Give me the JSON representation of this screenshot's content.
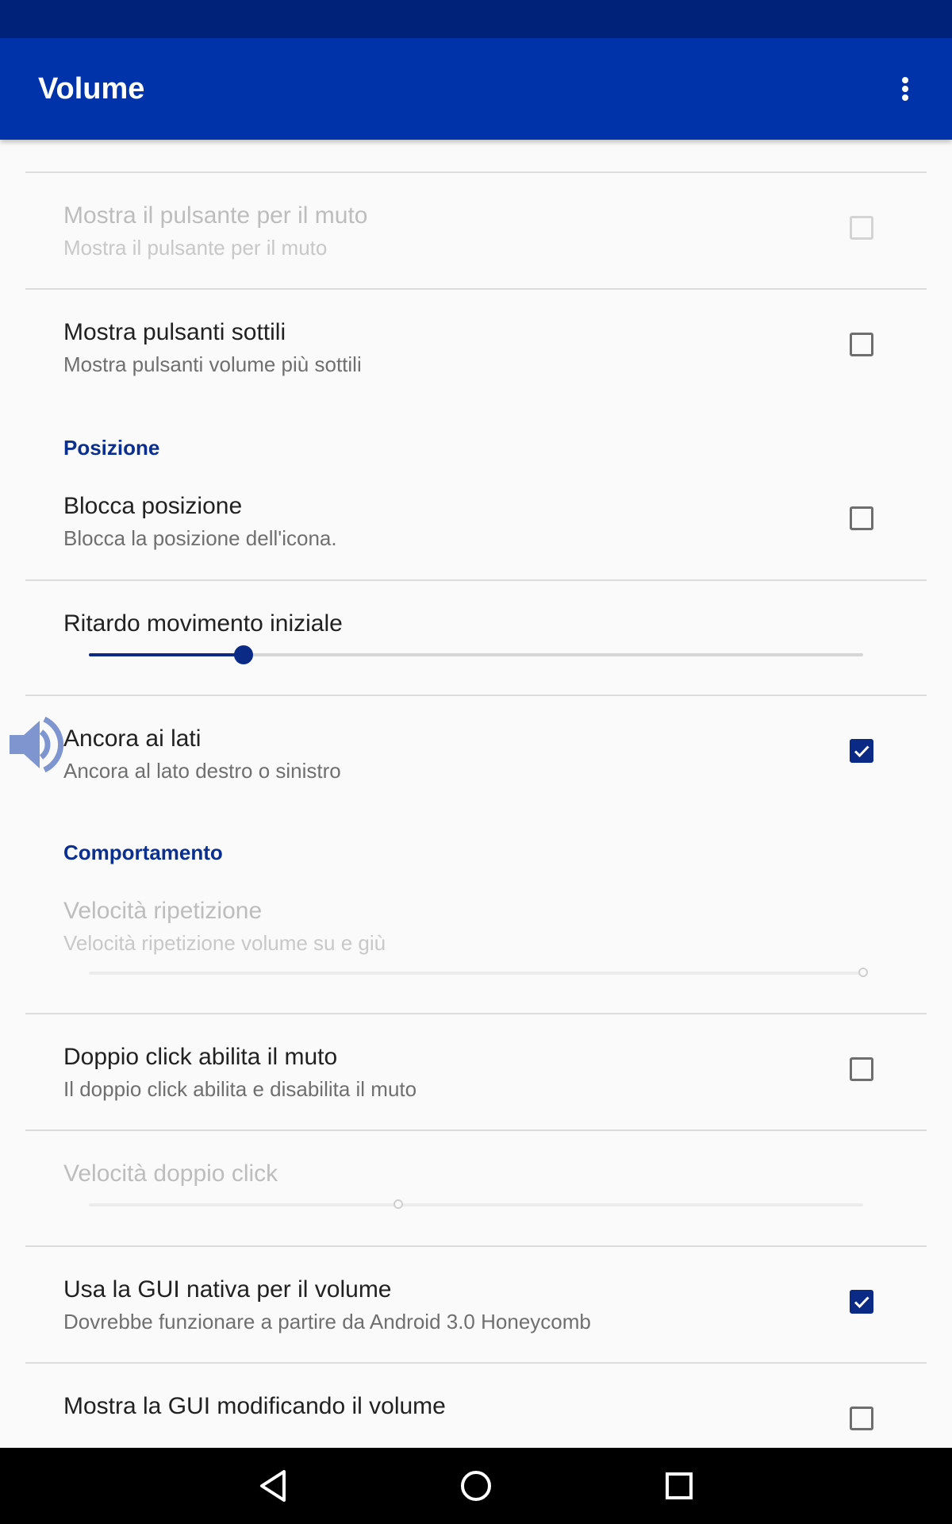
{
  "app_bar": {
    "title": "Volume",
    "overflow_icon": "more-vert-icon",
    "background": "#0033aa",
    "status_bar_color": "#00237a"
  },
  "accent_color": "#0a2a85",
  "preferences": {
    "mute_button": {
      "title": "Mostra il pulsante per il muto",
      "summary": "Mostra il pulsante per il muto",
      "checked": false,
      "enabled": false
    },
    "thin_buttons": {
      "title": "Mostra pulsanti sottili",
      "summary": "Mostra pulsanti volume più sottili",
      "checked": false,
      "enabled": true
    },
    "position_header": "Posizione",
    "lock_position": {
      "title": "Blocca posizione",
      "summary": "Blocca la posizione dell'icona.",
      "checked": false,
      "enabled": true
    },
    "initial_move_delay": {
      "title": "Ritardo movimento iniziale",
      "value": 0.2,
      "enabled": true
    },
    "anchor_sides": {
      "title": "Ancora ai lati",
      "summary": "Ancora al lato destro o sinistro",
      "checked": true,
      "enabled": true
    },
    "behavior_header": "Comportamento",
    "repeat_speed": {
      "title": "Velocità ripetizione",
      "summary": "Velocità ripetizione volume su e giù",
      "value": 1.0,
      "enabled": false
    },
    "double_click_mute": {
      "title": "Doppio click abilita il muto",
      "summary": "Il doppio click abilita e disabilita il muto",
      "checked": false,
      "enabled": true
    },
    "double_click_speed": {
      "title": "Velocità doppio click",
      "value": 0.4,
      "enabled": false
    },
    "native_gui": {
      "title": "Usa la GUI nativa per il volume",
      "summary": "Dovrebbe funzionare a partire da Android 3.0 Honeycomb",
      "checked": true,
      "enabled": true
    },
    "show_gui_on_change": {
      "title": "Mostra la GUI modificando il volume",
      "checked": false,
      "enabled": true
    }
  },
  "floating_widget": {
    "icon": "speaker-volume-icon"
  },
  "navigation_bar": {
    "back_icon": "back-triangle-icon",
    "home_icon": "home-circle-icon",
    "recents_icon": "recents-square-icon"
  }
}
